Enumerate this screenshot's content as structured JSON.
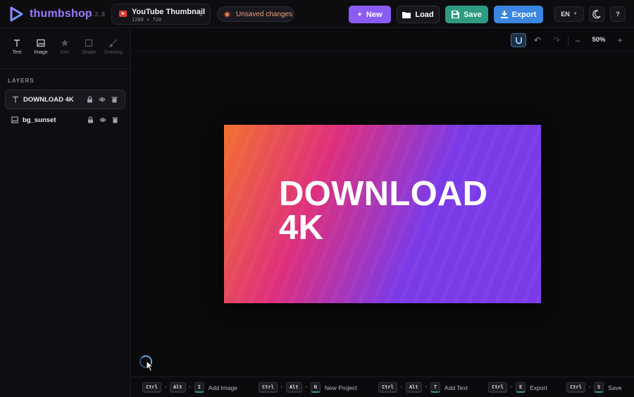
{
  "app": {
    "brand": "thumbshop",
    "version": "v1.2.0"
  },
  "project": {
    "name": "YouTube Thumbnail",
    "size": "1280 × 720",
    "icon": "youtube-icon"
  },
  "status": {
    "unsaved_label": "Unsaved changes",
    "color": "#f0805a"
  },
  "actions": {
    "new_label": "New",
    "load_label": "Load",
    "save_label": "Save",
    "export_label": "Export"
  },
  "language": {
    "selected": "EN"
  },
  "help": {
    "label": "?"
  },
  "tools": [
    {
      "label": "Text",
      "icon": "text-icon",
      "enabled": true
    },
    {
      "label": "Image",
      "icon": "image-icon",
      "enabled": true
    },
    {
      "label": "Icon",
      "icon": "star-icon",
      "enabled": false
    },
    {
      "label": "Shape",
      "icon": "square-icon",
      "enabled": false
    },
    {
      "label": "Drawing",
      "icon": "brush-icon",
      "enabled": false
    }
  ],
  "layers": {
    "title": "LAYERS",
    "items": [
      {
        "name": "DOWNLOAD 4K",
        "type": "text",
        "selected": true
      },
      {
        "name": "bg_sunset",
        "type": "image",
        "selected": false
      }
    ]
  },
  "canvas": {
    "zoom": "50%",
    "snap_enabled": true,
    "text": "DOWNLOAD 4K",
    "gradient": [
      "#f3702e",
      "#de2f7c",
      "#7b3ae8"
    ]
  },
  "shortcuts": [
    {
      "keys": [
        "Ctrl",
        "Alt",
        "I"
      ],
      "label": "Add Image"
    },
    {
      "keys": [
        "Ctrl",
        "Alt",
        "N"
      ],
      "label": "New Project"
    },
    {
      "keys": [
        "Ctrl",
        "Alt",
        "T"
      ],
      "label": "Add Text"
    },
    {
      "keys": [
        "Ctrl",
        "E"
      ],
      "label": "Export"
    },
    {
      "keys": [
        "Ctrl",
        "S"
      ],
      "label": "Save"
    }
  ],
  "colors": {
    "accent": "#8a5cf5",
    "save": "#2f9a82",
    "export": "#3b86e0"
  }
}
